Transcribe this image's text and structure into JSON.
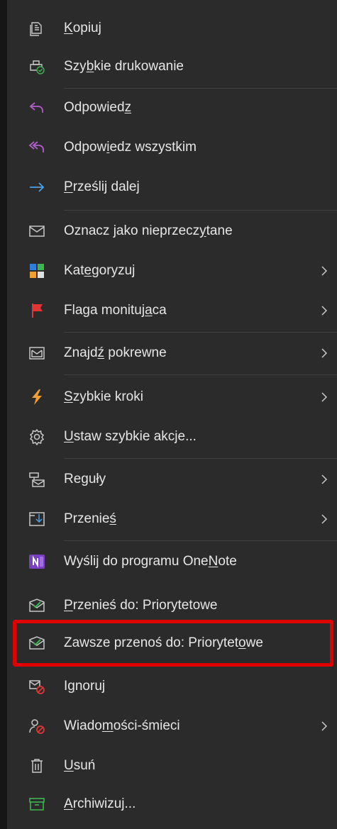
{
  "menu": {
    "items": [
      {
        "id": "copy",
        "pre": "",
        "u": "K",
        "post": "opiuj",
        "icon": "copy-icon"
      },
      {
        "id": "quick-print",
        "pre": "Szy",
        "u": "b",
        "post": "kie drukowanie",
        "icon": "printer-icon"
      },
      {
        "id": "reply",
        "pre": "Odpowied",
        "u": "z",
        "post": "",
        "icon": "reply-icon"
      },
      {
        "id": "reply-all",
        "pre": "Odpow",
        "u": "i",
        "post": "edz wszystkim",
        "icon": "reply-all-icon"
      },
      {
        "id": "forward",
        "pre": "",
        "u": "P",
        "post": "rześlij dalej",
        "icon": "forward-icon"
      },
      {
        "id": "mark-unread",
        "pre": "Oznacz jako nieprzecz",
        "u": "y",
        "post": "tane",
        "icon": "envelope-icon"
      },
      {
        "id": "categorize",
        "pre": "Kat",
        "u": "e",
        "post": "goryzuj",
        "icon": "categories-icon",
        "submenu": true
      },
      {
        "id": "follow-up",
        "pre": "Flaga monituj",
        "u": "a",
        "post": "ca",
        "icon": "flag-icon",
        "submenu": true
      },
      {
        "id": "find-related",
        "pre": "Znajd",
        "u": "ź",
        "post": " pokrewne",
        "icon": "find-related-icon",
        "submenu": true
      },
      {
        "id": "quick-steps",
        "pre": "",
        "u": "S",
        "post": "zybkie kroki",
        "icon": "lightning-icon",
        "submenu": true
      },
      {
        "id": "quick-actions",
        "pre": "",
        "u": "U",
        "post": "staw szybkie akcje...",
        "icon": "gear-icon"
      },
      {
        "id": "rules",
        "pre": "Reguły",
        "u": "",
        "post": "",
        "icon": "rules-icon",
        "submenu": true
      },
      {
        "id": "move",
        "pre": "Przenie",
        "u": "ś",
        "post": "",
        "icon": "move-icon",
        "submenu": true
      },
      {
        "id": "onenote",
        "pre": "Wyślij do programu One",
        "u": "N",
        "post": "ote",
        "icon": "onenote-icon"
      },
      {
        "id": "move-focused",
        "pre": "",
        "u": "P",
        "post": "rzenieś do: Priorytetowe",
        "icon": "focused-icon"
      },
      {
        "id": "always-move-focused",
        "pre": "Zawsze przenoś do: Priorytet",
        "u": "o",
        "post": "we",
        "icon": "focused-icon",
        "highlighted": true
      },
      {
        "id": "ignore",
        "pre": "I",
        "u": "g",
        "post": "noruj",
        "icon": "ignore-icon"
      },
      {
        "id": "junk",
        "pre": "Wiado",
        "u": "m",
        "post": "ości-śmieci",
        "icon": "junk-icon",
        "submenu": true
      },
      {
        "id": "delete",
        "pre": "",
        "u": "U",
        "post": "suń",
        "icon": "trash-icon"
      },
      {
        "id": "archive",
        "pre": "",
        "u": "A",
        "post": "rchiwizuj...",
        "icon": "archive-icon"
      }
    ],
    "colors": {
      "background": "#2b2b2b",
      "text": "#e6e6e6",
      "icon": "#c8c8c8",
      "purple": "#b05fc8",
      "blue": "#4f9fe6",
      "red": "#e03636",
      "green": "#3fb54f",
      "highlight_border": "#e00000"
    }
  }
}
